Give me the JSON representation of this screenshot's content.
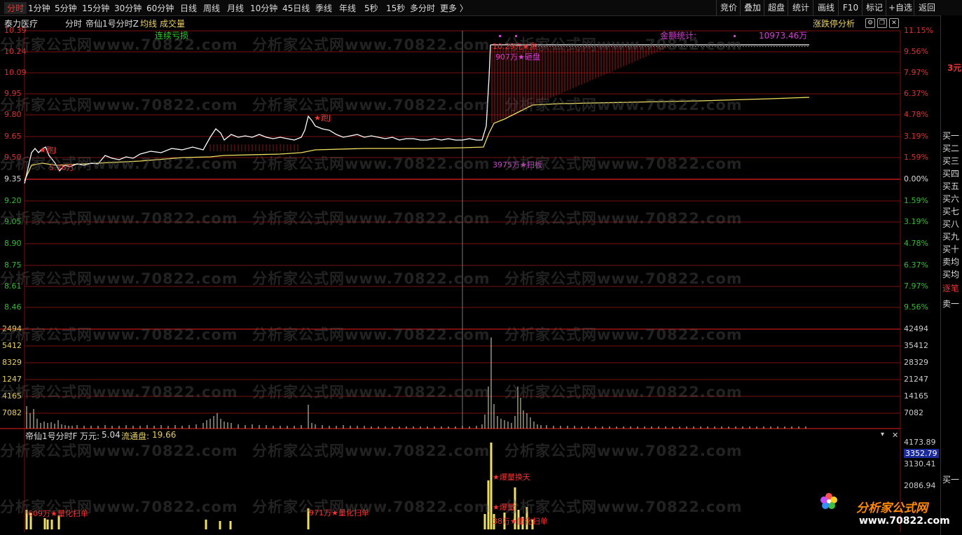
{
  "toolbar": {
    "periods": [
      "分时",
      "1分钟",
      "5分钟",
      "15分钟",
      "30分钟",
      "60分钟",
      "日线",
      "周线",
      "月线",
      "10分钟",
      "45日线",
      "季线",
      "年线",
      "5秒",
      "15秒",
      "多分时",
      "更多 〉"
    ],
    "active_period": "分时",
    "right_buttons": [
      "竞价",
      "叠加",
      "超盘",
      "统计",
      "画线",
      "F10",
      "标记",
      "+自选",
      "返回"
    ]
  },
  "header": {
    "stock_name": "泰力医疗",
    "mode": "分时",
    "indicator_name": "帝仙1号分时Z",
    "avg_line_label": "均线",
    "volume_label": "成交量",
    "indicator_series_label": "连续亏损",
    "amount_stat_label": "金额统计:",
    "amount_stat_value": "10973.46万",
    "limit_analysis_button": "涨跌停分析",
    "gear_icon": "gear-icon",
    "restore_icon": "restore-icon",
    "close_icon": "close-icon"
  },
  "price_axis": {
    "left": [
      "10.39",
      "10.24",
      "10.09",
      "9.95",
      "9.80",
      "9.65",
      "9.50",
      "9.35",
      "9.20",
      "9.05",
      "8.90",
      "8.75",
      "8.61",
      "8.46"
    ],
    "right": [
      "11.15%",
      "9.56%",
      "7.97%",
      "6.37%",
      "4.78%",
      "3.19%",
      "1.59%",
      "0.00%",
      "1.59%",
      "3.19%",
      "4.78%",
      "6.37%",
      "7.97%",
      "9.56%"
    ],
    "up_color": "#e03030",
    "down_color": "#30c030",
    "flat_color": "#dddddd"
  },
  "volume_axis": {
    "left": [
      "2494",
      "5412",
      "8329",
      "1247",
      "4165",
      "7082"
    ],
    "right": [
      "42494",
      "35412",
      "28329",
      "21247",
      "14165",
      "7082"
    ]
  },
  "annotations": {
    "limit_up_price": "10.29元★涨",
    "seal_board": "907万★砸盘",
    "sweep_board": "3975万★扫板",
    "star_j_1": "★跑J",
    "star_j_2": "★跑J",
    "low_hint": "5.36万"
  },
  "sub_panel": {
    "title": "帝仙1号分时F",
    "unit_label": "万元:",
    "unit_value": "5.04",
    "float_label": "流通盘:",
    "float_value": "19.66",
    "axis": [
      "4173.89",
      "3352.79",
      "3130.41",
      "2086.94"
    ],
    "highlight_value": "3352.79",
    "labels": {
      "quant_1": "609万★量化扫单",
      "quant_2": "971万★量化扫单",
      "turnover": "★爆量换天",
      "burst": "★爆量",
      "quant_3": "38万★量化扫单"
    },
    "dropdown_icon": "chevron-down-icon",
    "close_icon": "close-icon"
  },
  "side_panel": {
    "edge_number": "3元",
    "items": [
      "买一",
      "买二",
      "买三",
      "买四",
      "买五",
      "买六",
      "买七",
      "买八",
      "买九",
      "买十",
      "卖均",
      "买均",
      "逐笔",
      "卖一",
      "买一"
    ]
  },
  "watermark": {
    "text": "分析家公式网www.70822.com",
    "logo_text": "分析家公式网",
    "logo_url": "www.70822.com"
  },
  "colors": {
    "grid": "#7a0f0f",
    "price_line": "#ffffff",
    "avg_line": "#f0e060",
    "volume_bar": "#e0e0c0",
    "sub_bar": "#f0e060",
    "annotation_red": "#ff3030",
    "annotation_magenta": "#d040d0"
  }
}
